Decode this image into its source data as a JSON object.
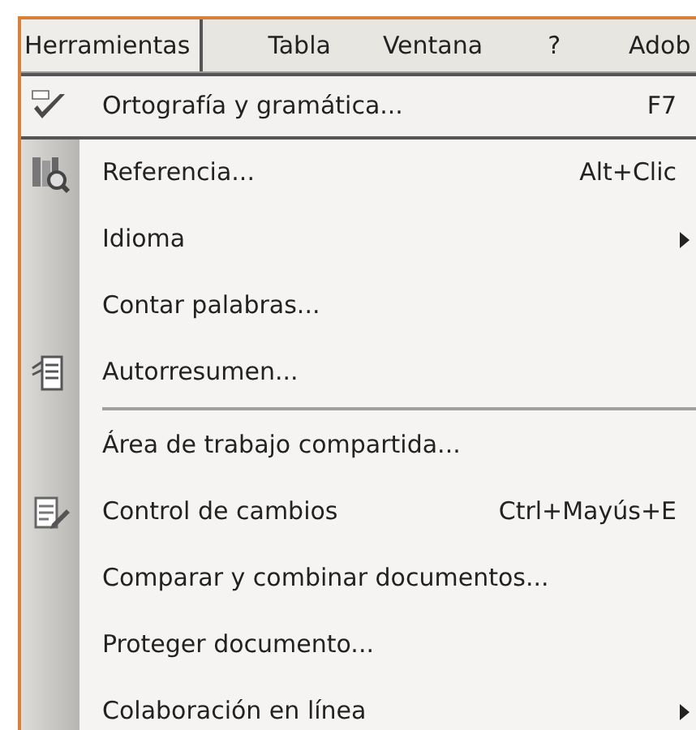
{
  "menu_bar": [
    {
      "label": "Herramientas",
      "selected": true
    },
    {
      "label": "Tabla",
      "selected": false
    },
    {
      "label": "Ventana",
      "selected": false
    },
    {
      "label": "?",
      "selected": false
    },
    {
      "label": "Adob",
      "selected": false
    }
  ],
  "menu": {
    "items": [
      {
        "kind": "spelling",
        "label": "Ortografía y gramática...",
        "shortcut": "F7",
        "selected": true
      },
      {
        "kind": "research",
        "label": "Referencia...",
        "shortcut": "Alt+Clic",
        "selected": false
      },
      {
        "kind": "submenu",
        "label": "Idioma",
        "selected": false
      },
      {
        "kind": "item",
        "label": "Contar palabras...",
        "selected": false
      },
      {
        "kind": "summary",
        "label": "Autorresumen...",
        "selected": false
      },
      {
        "kind": "separator"
      },
      {
        "kind": "item",
        "label": "Área de trabajo compartida...",
        "selected": false
      },
      {
        "kind": "tracking",
        "label": "Control de cambios",
        "shortcut": "Ctrl+Mayús+E",
        "selected": false
      },
      {
        "kind": "item",
        "label": "Comparar y combinar documentos...",
        "selected": false
      },
      {
        "kind": "item",
        "label": "Proteger documento...",
        "selected": false
      },
      {
        "kind": "submenu",
        "label": "Colaboración en línea",
        "selected": false
      }
    ]
  }
}
